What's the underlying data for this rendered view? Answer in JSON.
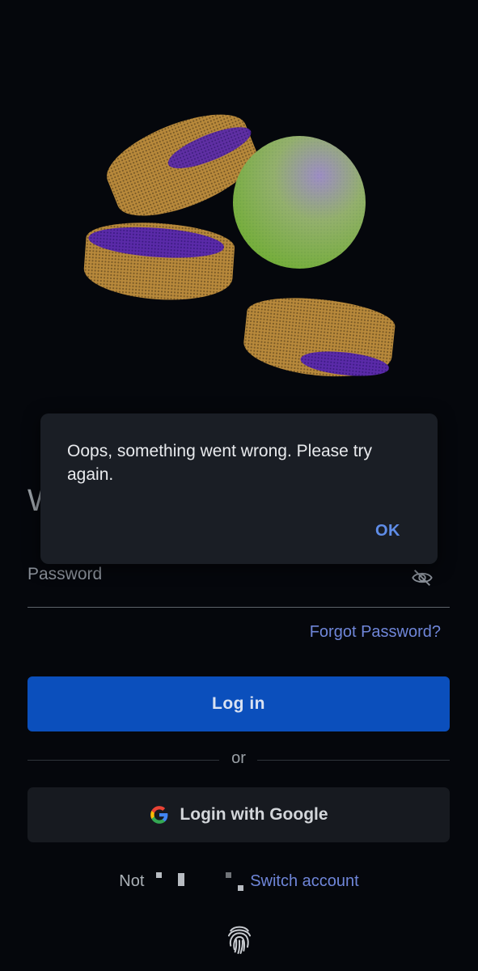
{
  "welcome_partial": "W",
  "password": {
    "placeholder": "Password",
    "toggle_icon": "eye-off-icon"
  },
  "forgot_password": "Forgot Password?",
  "login_button": "Log in",
  "divider_text": "or",
  "google_button": {
    "label": "Login with Google",
    "icon": "google-icon"
  },
  "account": {
    "not_prefix": "Not",
    "switch_label": "Switch account"
  },
  "fingerprint_icon": "fingerprint-icon",
  "dialog": {
    "message": "Oops, something went wrong. Please try again.",
    "ok_label": "OK"
  },
  "colors": {
    "background": "#05070c",
    "primary_button": "#0b4fbc",
    "link": "#6f86d9",
    "dialog_bg": "#1a1e25",
    "dialog_ok": "#5f8de8"
  }
}
